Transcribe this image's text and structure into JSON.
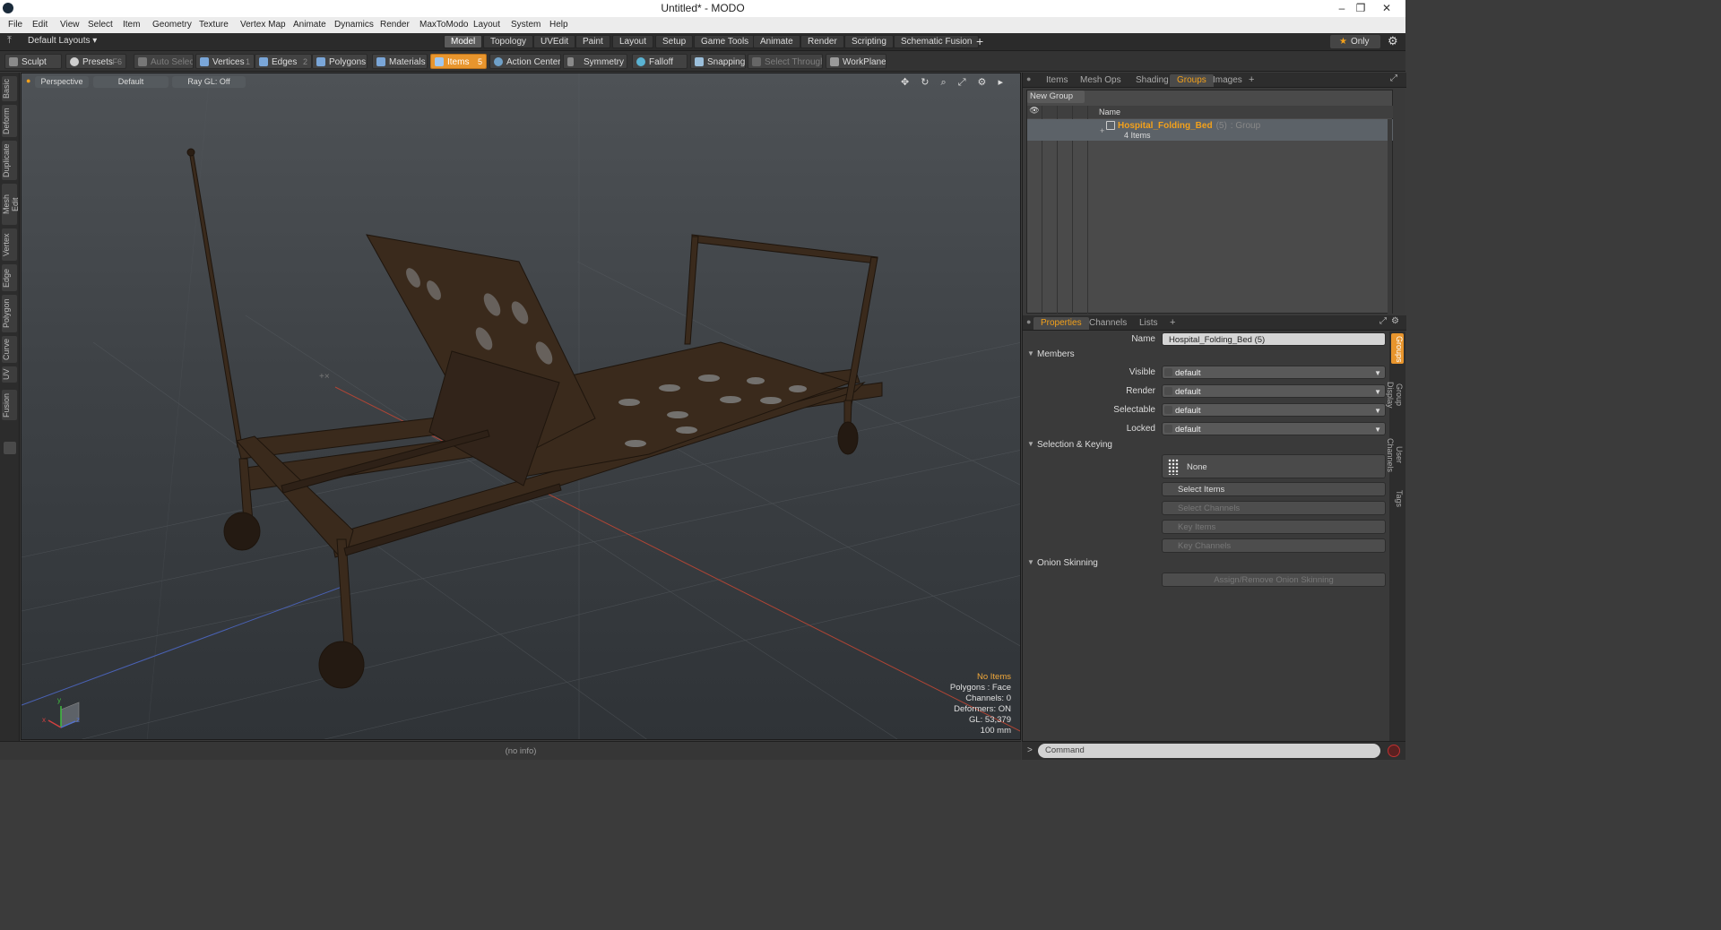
{
  "window": {
    "title": "Untitled* - MODO",
    "minimize": "–",
    "restore": "❐",
    "close": "✕"
  },
  "menu": [
    "File",
    "Edit",
    "View",
    "Select",
    "Item",
    "Geometry",
    "Texture",
    "Vertex Map",
    "Animate",
    "Dynamics",
    "Render",
    "MaxToModo",
    "Layout",
    "System",
    "Help"
  ],
  "layouts_label": "Default Layouts ▾",
  "layout_tabs": [
    "Model",
    "Topology",
    "UVEdit",
    "Paint",
    "Layout",
    "Setup",
    "Game Tools",
    "Animate",
    "Render",
    "Scripting",
    "Schematic Fusion"
  ],
  "active_layout_tab": "Model",
  "add_tab_label": "+",
  "only_label": "Only",
  "toolbar": {
    "sculpt": "Sculpt",
    "presets": "Presets",
    "presets_key": "F6",
    "auto_select": "Auto Select",
    "vertices": "Vertices",
    "vertices_key": "1",
    "edges": "Edges",
    "edges_key": "2",
    "polygons": "Polygons",
    "materials": "Materials",
    "items": "Items",
    "items_key": "5",
    "action_center": "Action Center",
    "symmetry": "Symmetry",
    "falloff": "Falloff",
    "snapping": "Snapping",
    "select_through": "Select Through",
    "workplane": "WorkPlane"
  },
  "left_tabs": [
    "Basic",
    "Deform",
    "Duplicate",
    "Mesh Edit",
    "Vertex",
    "Edge",
    "Polygon",
    "Curve",
    "UV",
    "Fusion"
  ],
  "viewport": {
    "view": "Perspective",
    "shading": "Default",
    "raygl": "Ray GL: Off",
    "icons": "✥ ↻ ⌕ ⤢ ⚙ ▸",
    "stats": {
      "no_items": "No Items",
      "polygons": "Polygons : Face",
      "channels": "Channels: 0",
      "deformers": "Deformers: ON",
      "gl": "GL: 53,379",
      "unit": "100 mm"
    },
    "axis_labels": {
      "x": "x",
      "y": "y",
      "z": "z"
    }
  },
  "status_text": "(no info)",
  "top_panel": {
    "tabs": [
      "Items",
      "Mesh Ops",
      "Shading",
      "Groups",
      "Images"
    ],
    "active_tab": "Groups",
    "new_group": "New Group",
    "name_header": "Name",
    "group": {
      "name": "Hospital_Folding_Bed",
      "count": "(5)",
      "type": ": Group",
      "items": "4 Items"
    }
  },
  "bottom_panel": {
    "tabs": [
      "Properties",
      "Channels",
      "Lists"
    ],
    "active_tab": "Properties",
    "name_label": "Name",
    "name_value": "Hospital_Folding_Bed (5)",
    "members_section": "Members",
    "fields": [
      {
        "label": "Visible",
        "value": "default"
      },
      {
        "label": "Render",
        "value": "default"
      },
      {
        "label": "Selectable",
        "value": "default"
      },
      {
        "label": "Locked",
        "value": "default"
      }
    ],
    "selection_section": "Selection & Keying",
    "none_label": "None",
    "select_items": "Select Items",
    "select_channels": "Select Channels",
    "key_items": "Key Items",
    "key_channels": "Key Channels",
    "onion_section": "Onion Skinning",
    "assign_onion": "Assign/Remove Onion Skinning",
    "side_tabs": [
      "Groups",
      "Group Display",
      "User Channels",
      "Tags"
    ]
  },
  "command": {
    "prompt": ">",
    "placeholder": "Command"
  },
  "colors": {
    "accent": "#e8952d",
    "group_name": "#f3a11b",
    "bed_wood": "#3a2a1c"
  }
}
